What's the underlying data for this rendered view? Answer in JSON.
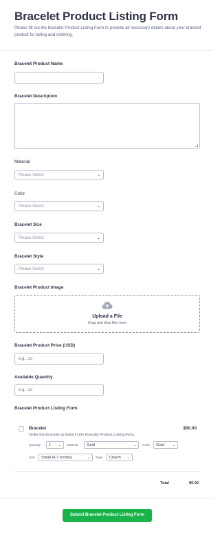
{
  "header": {
    "title": "Bracelet Product Listing Form",
    "subtitle": "Please fill out the Bracelet Product Listing Form to provide all necessary details about your bracelet product for listing and ordering."
  },
  "fields": {
    "product_name": {
      "label": "Bracelet Product Name",
      "value": ""
    },
    "description": {
      "label": "Bracelet Description",
      "value": ""
    },
    "material": {
      "label": "Material",
      "placeholder": "Please Select"
    },
    "color": {
      "label": "Color",
      "placeholder": "Please Select"
    },
    "size": {
      "label": "Bracelet Size",
      "placeholder": "Please Select"
    },
    "style": {
      "label": "Bracelet Style",
      "placeholder": "Please Select"
    },
    "image": {
      "label": "Bracelet Product Image",
      "upload_title": "Upload a File",
      "upload_sub": "Drag and drop files here",
      "icon": "cloud-upload-icon"
    },
    "price": {
      "label": "Bracelet Product Price (USD)",
      "placeholder": "e.g., 23"
    },
    "quantity": {
      "label": "Available Quantity",
      "placeholder": "e.g., 23"
    }
  },
  "listing": {
    "label": "Bracelet Product Listing Form",
    "product": {
      "name": "Bracelet",
      "price": "$50.00",
      "description": "Order this bracelet as listed in the Bracelet Product Listing Form.",
      "options": {
        "quantity_label": "Quantity",
        "quantity_value": "1",
        "material_label": "Material",
        "material_value": "Gold",
        "color_label": "Color",
        "color_value": "Gold",
        "size_label": "Size",
        "size_value": "Small (6-7 inches)",
        "style_label": "Style",
        "style_value": "Charm"
      }
    },
    "total_label": "Total",
    "total_value": "$0.00"
  },
  "submit_label": "Submit Bracelet Product Listing Form",
  "colors": {
    "accent": "#18b449",
    "text": "#2c3345",
    "muted": "#57647e",
    "border": "#b8bdc9"
  }
}
